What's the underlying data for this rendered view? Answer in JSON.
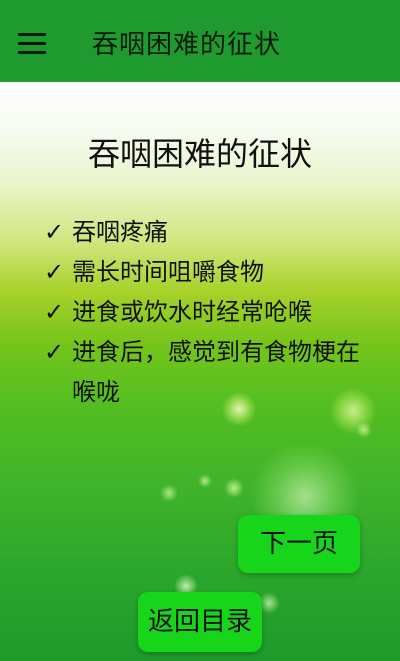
{
  "app_bar": {
    "menu_icon": "hamburger-menu-icon",
    "title": "吞咽困难的征状"
  },
  "main": {
    "page_title": "吞咽困难的征状",
    "check_glyph": "✓",
    "symptoms": [
      "吞咽疼痛",
      "需长时间咀嚼食物",
      "进食或饮水时经常呛喉",
      "进食后，感觉到有食物梗在喉咙"
    ]
  },
  "buttons": {
    "next_label": "下一页",
    "back_label": "返回目录"
  },
  "colors": {
    "app_bar": "#1f9a2e",
    "button": "#17d51b",
    "text": "#111111"
  }
}
